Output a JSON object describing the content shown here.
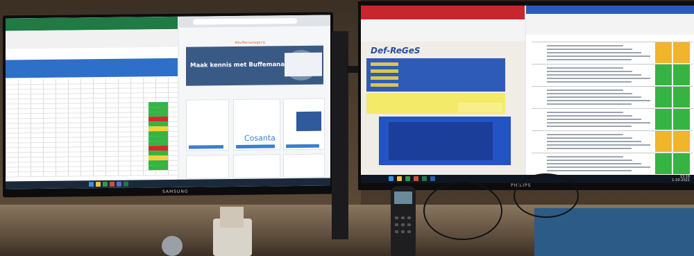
{
  "left_monitor": {
    "brand": "SAMSUNG",
    "browser": {
      "hero_title": "Maak kennis met Buffemanagert",
      "brand_line": "#buffemanager'e",
      "sponsor": "Cosanta"
    }
  },
  "right_monitor": {
    "brand": "PHILIPS",
    "app_title": "Def-ReGeS",
    "clock_time": "13:19",
    "clock_date": "1-10-2021"
  },
  "colors": {
    "excel_green": "#1f7a44",
    "excel_header_blue": "#2e6fc9",
    "cell_green": "#35b444",
    "cell_red": "#d12a2a",
    "cell_yellow": "#f2d13a",
    "app_red": "#c8262e",
    "app_blue": "#2f5bb8",
    "word_blue": "#2a5bb4",
    "status_orange": "#f1b52a"
  }
}
